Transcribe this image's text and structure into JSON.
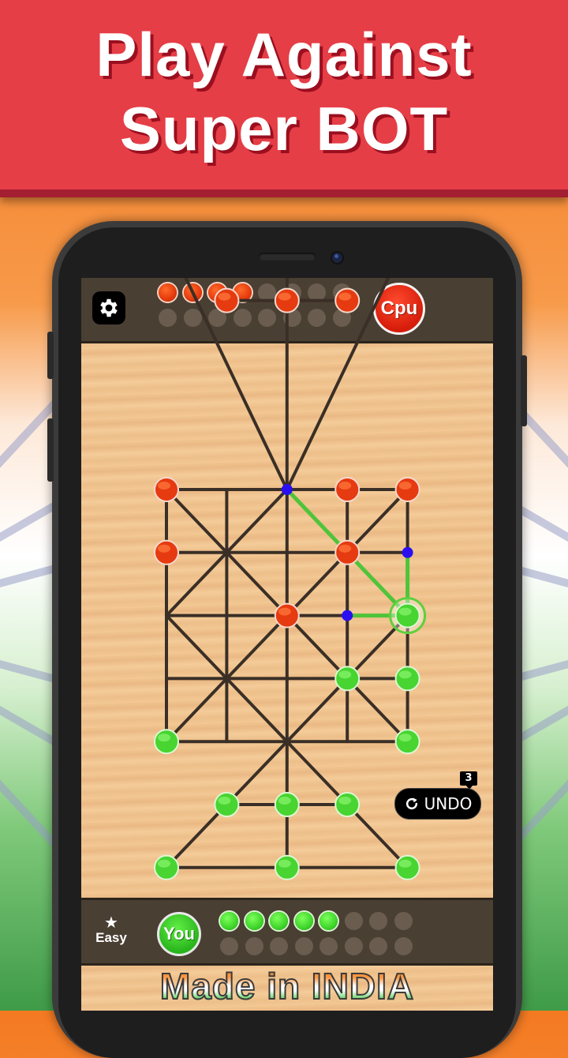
{
  "banner": {
    "line1": "Play  Against",
    "line2": "Super BOT"
  },
  "colors": {
    "banner": "#e53e46",
    "cpu": "#e43a0c",
    "player": "#3fd52a",
    "highlight_path": "#4fc43a",
    "move_hint": "#2a10f0"
  },
  "game": {
    "cpu_label": "Cpu",
    "player_label": "You",
    "difficulty": "Easy",
    "difficulty_icon": "star-icon",
    "settings_icon": "gear-icon",
    "cpu_captured": 4,
    "cpu_slots": 16,
    "player_captured": 5,
    "player_slots": 16,
    "undo_label": "UNDO",
    "undo_icon": "refresh-icon",
    "undo_remaining": "3",
    "footer": "Made in INDIA"
  },
  "board": {
    "nodes": [
      {
        "id": "t1",
        "col": 0,
        "row": -4,
        "piece": "red"
      },
      {
        "id": "t2",
        "col": 2,
        "row": -4,
        "piece": "red"
      },
      {
        "id": "t3",
        "col": 4,
        "row": -4,
        "piece": "red"
      },
      {
        "id": "t4",
        "col": 1,
        "row": -3,
        "piece": "red"
      },
      {
        "id": "t5",
        "col": 2,
        "row": -3,
        "piece": "red"
      },
      {
        "id": "t6",
        "col": 3,
        "row": -3,
        "piece": "red"
      },
      {
        "id": "g00",
        "col": 0,
        "row": 0,
        "piece": "red"
      },
      {
        "id": "g10",
        "col": 1,
        "row": 0,
        "piece": null
      },
      {
        "id": "g20",
        "col": 2,
        "row": 0,
        "piece": "hint"
      },
      {
        "id": "g30",
        "col": 3,
        "row": 0,
        "piece": "red"
      },
      {
        "id": "g40",
        "col": 4,
        "row": 0,
        "piece": "red"
      },
      {
        "id": "g01",
        "col": 0,
        "row": 1,
        "piece": "red"
      },
      {
        "id": "g11",
        "col": 1,
        "row": 1,
        "piece": null
      },
      {
        "id": "g21",
        "col": 2,
        "row": 1,
        "piece": null
      },
      {
        "id": "g31",
        "col": 3,
        "row": 1,
        "piece": "red"
      },
      {
        "id": "g41",
        "col": 4,
        "row": 1,
        "piece": "hint"
      },
      {
        "id": "g02",
        "col": 0,
        "row": 2,
        "piece": null
      },
      {
        "id": "g12",
        "col": 1,
        "row": 2,
        "piece": null
      },
      {
        "id": "g22",
        "col": 2,
        "row": 2,
        "piece": "red"
      },
      {
        "id": "g32",
        "col": 3,
        "row": 2,
        "piece": "hint"
      },
      {
        "id": "g42",
        "col": 4,
        "row": 2,
        "piece": "green",
        "selected": true
      },
      {
        "id": "g03",
        "col": 0,
        "row": 3,
        "piece": null
      },
      {
        "id": "g13",
        "col": 1,
        "row": 3,
        "piece": null
      },
      {
        "id": "g23",
        "col": 2,
        "row": 3,
        "piece": null
      },
      {
        "id": "g33",
        "col": 3,
        "row": 3,
        "piece": "green"
      },
      {
        "id": "g43",
        "col": 4,
        "row": 3,
        "piece": "green"
      },
      {
        "id": "g04",
        "col": 0,
        "row": 4,
        "piece": "green"
      },
      {
        "id": "g14",
        "col": 1,
        "row": 4,
        "piece": null
      },
      {
        "id": "g24",
        "col": 2,
        "row": 4,
        "piece": null
      },
      {
        "id": "g34",
        "col": 3,
        "row": 4,
        "piece": null
      },
      {
        "id": "g44",
        "col": 4,
        "row": 4,
        "piece": "green"
      },
      {
        "id": "b4",
        "col": 1,
        "row": 5,
        "piece": "green"
      },
      {
        "id": "b5",
        "col": 2,
        "row": 5,
        "piece": "green"
      },
      {
        "id": "b6",
        "col": 3,
        "row": 5,
        "piece": "green"
      },
      {
        "id": "b1",
        "col": 0,
        "row": 6,
        "piece": "green"
      },
      {
        "id": "b2",
        "col": 2,
        "row": 6,
        "piece": "green"
      },
      {
        "id": "b3",
        "col": 4,
        "row": 6,
        "piece": "green"
      }
    ],
    "highlight_paths": [
      [
        [
          4,
          2
        ],
        [
          3,
          1
        ],
        [
          2,
          0
        ]
      ],
      [
        [
          4,
          2
        ],
        [
          4,
          1
        ]
      ],
      [
        [
          4,
          2
        ],
        [
          3,
          2
        ]
      ]
    ]
  }
}
